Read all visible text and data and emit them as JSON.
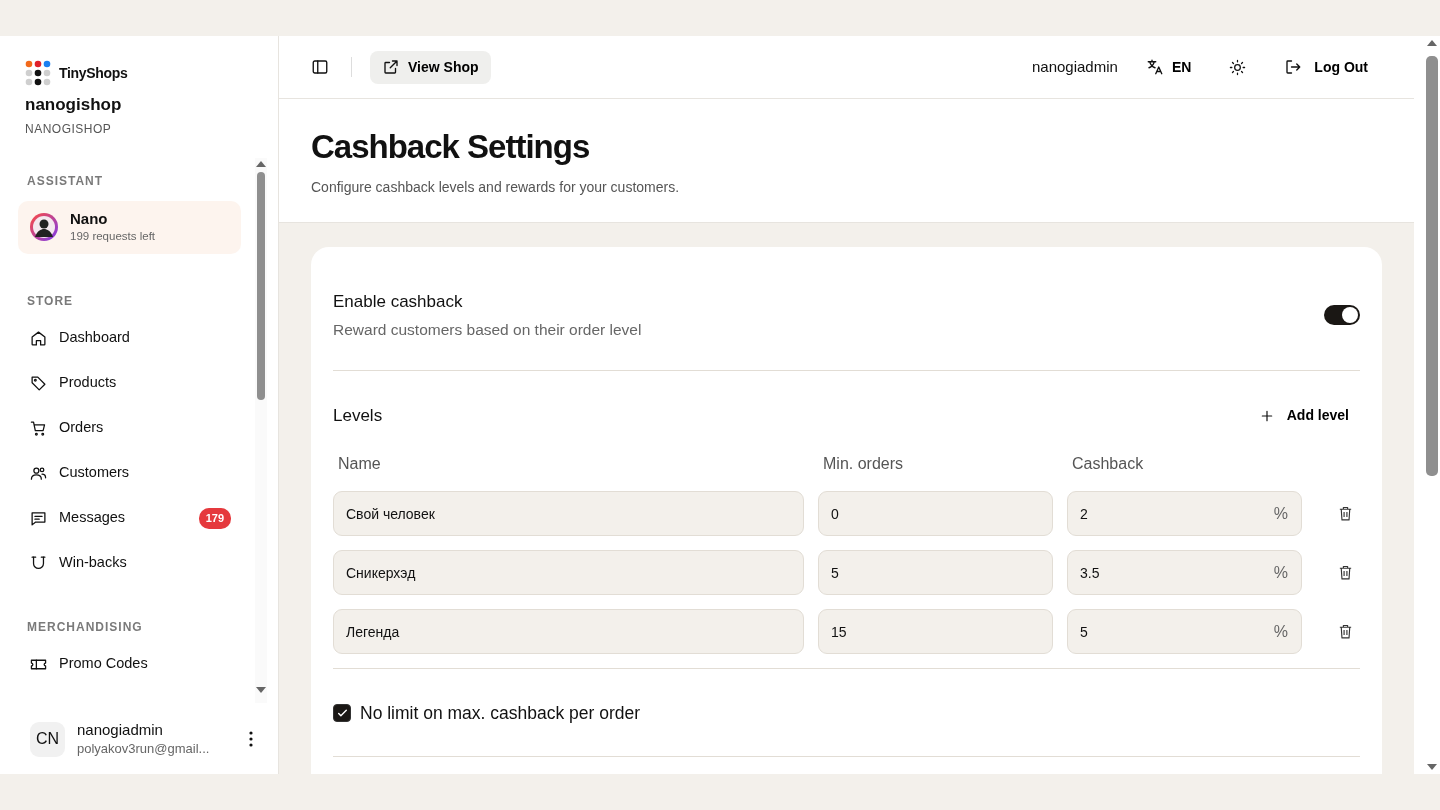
{
  "brand": {
    "name": "TinyShops"
  },
  "shop": {
    "name": "nanogishop",
    "handle": "NANOGISHOP"
  },
  "assistant": {
    "title": "ASSISTANT",
    "name": "Nano",
    "subtitle": "199 requests left",
    "selected": true
  },
  "sidebar": {
    "sections": [
      {
        "title": "STORE",
        "items": [
          {
            "label": "Dashboard"
          },
          {
            "label": "Products"
          },
          {
            "label": "Orders"
          },
          {
            "label": "Customers"
          },
          {
            "label": "Messages",
            "badge": "179"
          },
          {
            "label": "Win-backs"
          }
        ]
      },
      {
        "title": "MERCHANDISING",
        "items": [
          {
            "label": "Promo Codes"
          }
        ]
      }
    ]
  },
  "user": {
    "initials": "CN",
    "name": "nanogiadmin",
    "email": "polyakov3run@gmail..."
  },
  "topbar": {
    "view_shop": "View Shop",
    "username": "nanogiadmin",
    "language": "EN",
    "logout": "Log Out"
  },
  "page": {
    "title": "Cashback Settings",
    "subtitle": "Configure cashback levels and rewards for your customers."
  },
  "enable": {
    "label": "Enable cashback",
    "description": "Reward customers based on their order level",
    "on": true
  },
  "levels": {
    "title": "Levels",
    "add_button": "Add level",
    "columns": [
      "Name",
      "Min. orders",
      "Cashback"
    ],
    "rows": [
      {
        "name": "Свой человек",
        "min_orders": "0",
        "cashback": "2",
        "unit": "%"
      },
      {
        "name": "Сникерхэд",
        "min_orders": "5",
        "cashback": "3.5",
        "unit": "%"
      },
      {
        "name": "Легенда",
        "min_orders": "15",
        "cashback": "5",
        "unit": "%"
      }
    ]
  },
  "no_limit": {
    "label": "No limit on max. cashback per order",
    "checked": true
  }
}
